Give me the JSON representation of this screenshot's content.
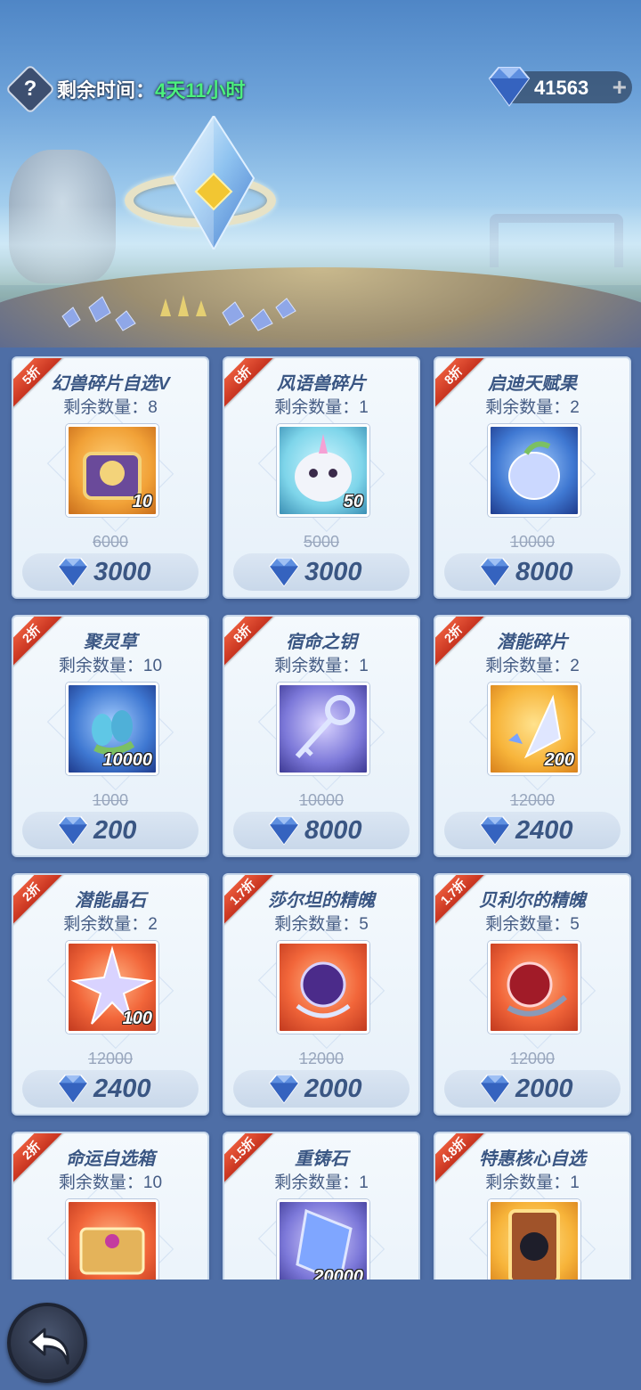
{
  "header": {
    "help_icon": "?",
    "time_label": "剩余时间：",
    "time_value": "4天11小时",
    "currency_amount": "41563",
    "add_icon": "+"
  },
  "colors": {
    "ribbon": "#d6432a",
    "price_text": "#3a5683",
    "time_value": "#4cf07e"
  },
  "cards": [
    {
      "discount": "5折",
      "name": "幻兽碎片自选V",
      "stock": "剩余数量：8",
      "qty": "10",
      "orig": "6000",
      "price": "3000",
      "icon": "chest-icon"
    },
    {
      "discount": "6折",
      "name": "风语兽碎片",
      "stock": "剩余数量：1",
      "qty": "50",
      "orig": "5000",
      "price": "3000",
      "icon": "white-beast-icon"
    },
    {
      "discount": "8折",
      "name": "启迪天赋果",
      "stock": "剩余数量：2",
      "qty": "",
      "orig": "10000",
      "price": "8000",
      "icon": "fruit-icon"
    },
    {
      "discount": "2折",
      "name": "聚灵草",
      "stock": "剩余数量：10",
      "qty": "10000",
      "orig": "1000",
      "price": "200",
      "icon": "herb-icon"
    },
    {
      "discount": "8折",
      "name": "宿命之钥",
      "stock": "剩余数量：1",
      "qty": "",
      "orig": "10000",
      "price": "8000",
      "icon": "key-icon"
    },
    {
      "discount": "2折",
      "name": "潜能碎片",
      "stock": "剩余数量：2",
      "qty": "200",
      "orig": "12000",
      "price": "2400",
      "icon": "shard-icon"
    },
    {
      "discount": "2折",
      "name": "潜能晶石",
      "stock": "剩余数量：2",
      "qty": "100",
      "orig": "12000",
      "price": "2400",
      "icon": "star-crystal-icon"
    },
    {
      "discount": "1.7折",
      "name": "莎尔坦的精魄",
      "stock": "剩余数量：5",
      "qty": "",
      "orig": "12000",
      "price": "2000",
      "icon": "purple-orb-icon"
    },
    {
      "discount": "1.7折",
      "name": "贝利尔的精魄",
      "stock": "剩余数量：5",
      "qty": "",
      "orig": "12000",
      "price": "2000",
      "icon": "red-orb-icon"
    },
    {
      "discount": "2折",
      "name": "命运自选箱",
      "stock": "剩余数量：10",
      "qty": "",
      "orig": "",
      "price": "",
      "icon": "gold-box-icon"
    },
    {
      "discount": "1.5折",
      "name": "重铸石",
      "stock": "剩余数量：1",
      "qty": "20000",
      "orig": "",
      "price": "",
      "icon": "blue-stone-icon"
    },
    {
      "discount": "4.8折",
      "name": "特惠核心自选",
      "stock": "剩余数量：1",
      "qty": "",
      "orig": "",
      "price": "",
      "icon": "core-card-icon"
    }
  ]
}
